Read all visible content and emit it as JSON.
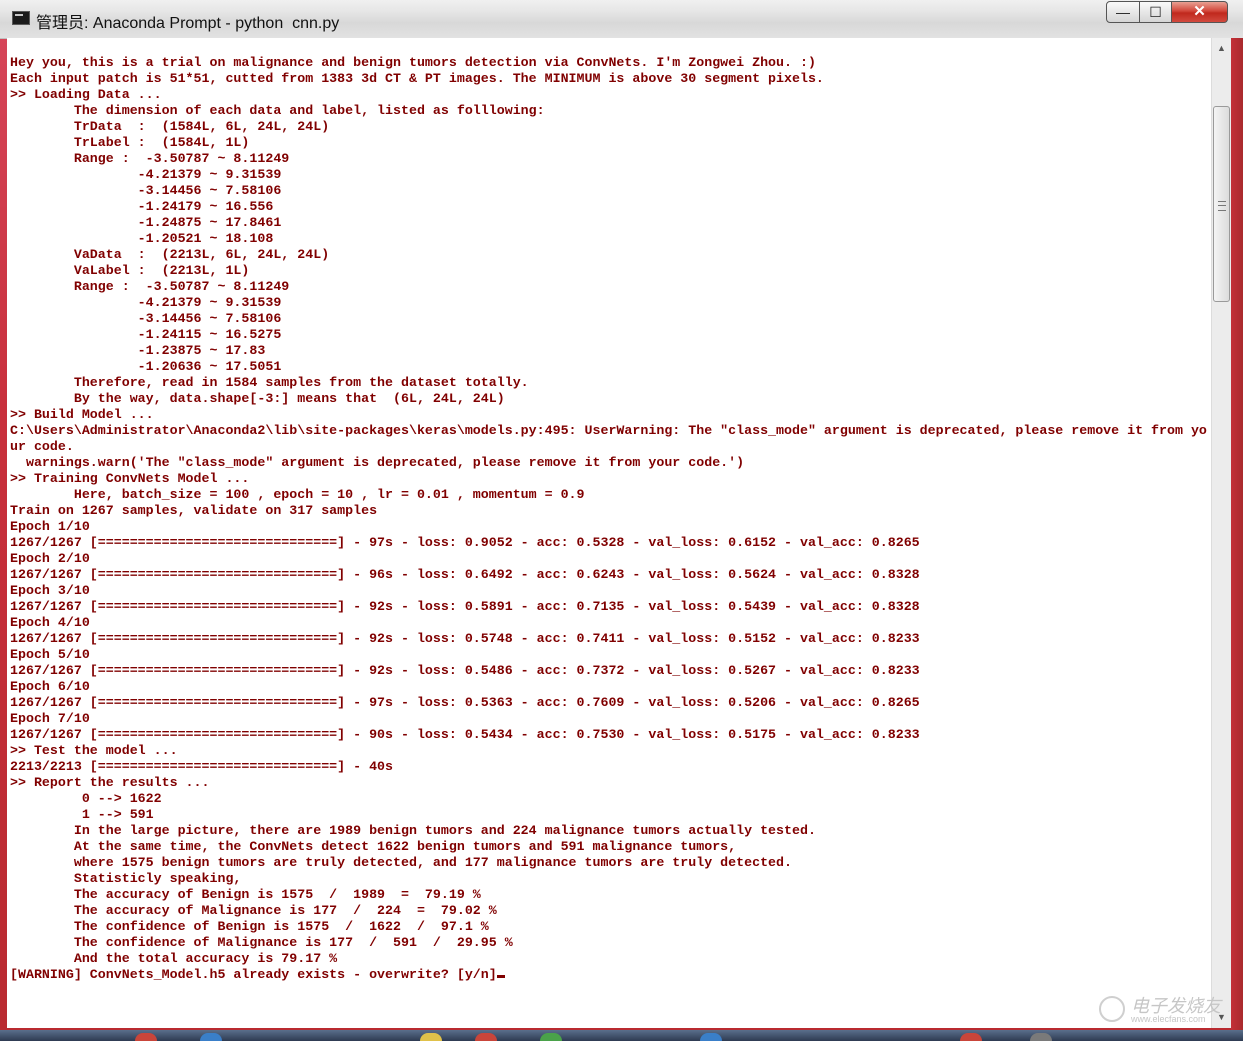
{
  "window": {
    "title": "管理员: Anaconda Prompt - python  cnn.py",
    "controls": {
      "minimize": "—",
      "maximize": "☐",
      "close": "✕"
    }
  },
  "console": {
    "lines": [
      "Hey you, this is a trial on malignance and benign tumors detection via ConvNets. I'm Zongwei Zhou. :)",
      "Each input patch is 51*51, cutted from 1383 3d CT & PT images. The MINIMUM is above 30 segment pixels.",
      ">> Loading Data ...",
      "        The dimension of each data and label, listed as folllowing:",
      "        TrData  :  (1584L, 6L, 24L, 24L)",
      "        TrLabel :  (1584L, 1L)",
      "        Range :  -3.50787 ~ 8.11249",
      "                -4.21379 ~ 9.31539",
      "                -3.14456 ~ 7.58106",
      "                -1.24179 ~ 16.556",
      "                -1.24875 ~ 17.8461",
      "                -1.20521 ~ 18.108",
      "        VaData  :  (2213L, 6L, 24L, 24L)",
      "        VaLabel :  (2213L, 1L)",
      "        Range :  -3.50787 ~ 8.11249",
      "                -4.21379 ~ 9.31539",
      "                -3.14456 ~ 7.58106",
      "                -1.24115 ~ 16.5275",
      "                -1.23875 ~ 17.83",
      "                -1.20636 ~ 17.5051",
      "        Therefore, read in 1584 samples from the dataset totally.",
      "        By the way, data.shape[-3:] means that  (6L, 24L, 24L)",
      ">> Build Model ...",
      "C:\\Users\\Administrator\\Anaconda2\\lib\\site-packages\\keras\\models.py:495: UserWarning: The \"class_mode\" argument is deprecated, please remove it from yo",
      "ur code.",
      "  warnings.warn('The \"class_mode\" argument is deprecated, please remove it from your code.')",
      ">> Training ConvNets Model ...",
      "        Here, batch_size = 100 , epoch = 10 , lr = 0.01 , momentum = 0.9",
      "Train on 1267 samples, validate on 317 samples",
      "Epoch 1/10",
      "1267/1267 [==============================] - 97s - loss: 0.9052 - acc: 0.5328 - val_loss: 0.6152 - val_acc: 0.8265",
      "Epoch 2/10",
      "1267/1267 [==============================] - 96s - loss: 0.6492 - acc: 0.6243 - val_loss: 0.5624 - val_acc: 0.8328",
      "Epoch 3/10",
      "1267/1267 [==============================] - 92s - loss: 0.5891 - acc: 0.7135 - val_loss: 0.5439 - val_acc: 0.8328",
      "Epoch 4/10",
      "1267/1267 [==============================] - 92s - loss: 0.5748 - acc: 0.7411 - val_loss: 0.5152 - val_acc: 0.8233",
      "Epoch 5/10",
      "1267/1267 [==============================] - 92s - loss: 0.5486 - acc: 0.7372 - val_loss: 0.5267 - val_acc: 0.8233",
      "Epoch 6/10",
      "1267/1267 [==============================] - 97s - loss: 0.5363 - acc: 0.7609 - val_loss: 0.5206 - val_acc: 0.8265",
      "Epoch 7/10",
      "1267/1267 [==============================] - 90s - loss: 0.5434 - acc: 0.7530 - val_loss: 0.5175 - val_acc: 0.8233",
      ">> Test the model ...",
      "2213/2213 [==============================] - 40s",
      ">> Report the results ...",
      "         0 --> 1622",
      "         1 --> 591",
      "        In the large picture, there are 1989 benign tumors and 224 malignance tumors actually tested.",
      "        At the same time, the ConvNets detect 1622 benign tumors and 591 malignance tumors,",
      "        where 1575 benign tumors are truly detected, and 177 malignance tumors are truly detected.",
      "        Statisticly speaking,",
      "        The accuracy of Benign is 1575  /  1989  =  79.19 %",
      "        The accuracy of Malignance is 177  /  224  =  79.02 %",
      "        The confidence of Benign is 1575  /  1622  /  97.1 %",
      "        The confidence of Malignance is 177  /  591  /  29.95 %",
      "        And the total accuracy is 79.17 %",
      "[WARNING] ConvNets_Model.h5 already exists - overwrite? [y/n]"
    ]
  },
  "scrollbar": {
    "up_arrow": "▲",
    "down_arrow": "▼"
  },
  "watermark": {
    "text": "电子发烧友",
    "url": "www.elecfans.com"
  },
  "colors": {
    "console_text": "#800000",
    "console_bg": "#ffffff",
    "window_frame": "#c8303c"
  }
}
